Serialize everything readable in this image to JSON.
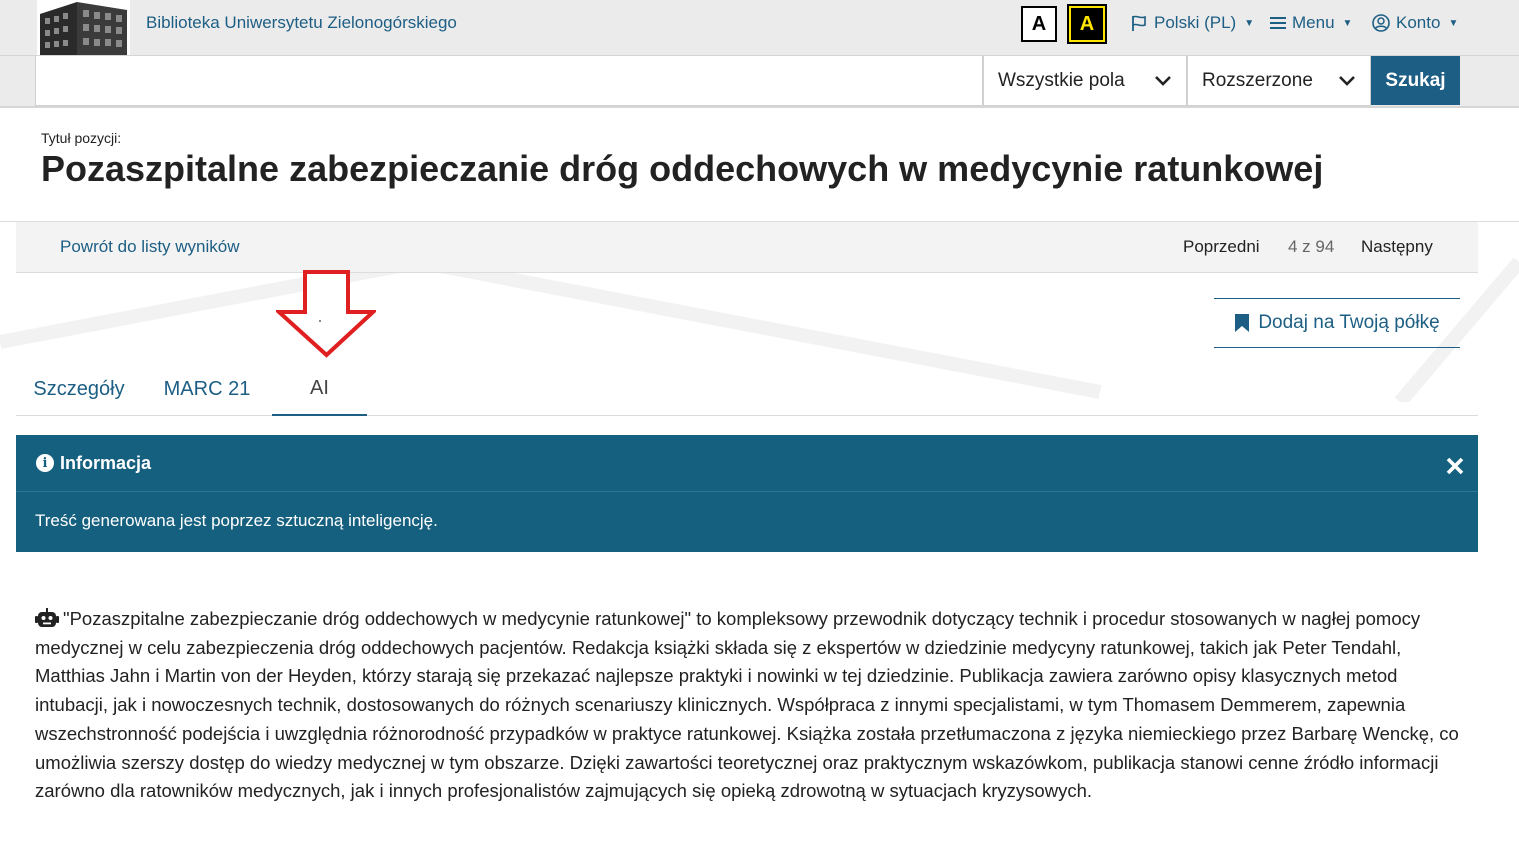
{
  "header": {
    "site_name": "Biblioteka Uniwersytetu Zielonogórskiego",
    "contrast_normal_label": "A",
    "contrast_high_label": "A",
    "language_label": "Polski (PL)",
    "menu_label": "Menu",
    "account_label": "Konto"
  },
  "search": {
    "query": "",
    "field_select": "Wszystkie pola",
    "mode_select": "Rozszerzone",
    "submit_label": "Szukaj"
  },
  "record": {
    "title_label": "Tytuł pozycji:",
    "title": "Pozaszpitalne zabezpieczanie dróg oddechowych w medycynie ratunkowej"
  },
  "result_nav": {
    "back_label": "Powrót do listy wyników",
    "prev_label": "Poprzedni",
    "counter": "4 z 94",
    "next_label": "Następny"
  },
  "shelf": {
    "label": "Dodaj na Twoją półkę"
  },
  "tabs": [
    {
      "label": "Szczegóły",
      "active": false
    },
    {
      "label": "MARC 21",
      "active": false
    },
    {
      "label": "AI",
      "active": true
    }
  ],
  "alert": {
    "title": "Informacja",
    "body": "Treść generowana jest poprzez sztuczną inteligencję."
  },
  "ai_summary": {
    "text": "\"Pozaszpitalne zabezpieczanie dróg oddechowych w medycynie ratunkowej\" to kompleksowy przewodnik dotyczący technik i procedur stosowanych w nagłej pomocy medycznej w celu zabezpieczenia dróg oddechowych pacjentów. Redakcja książki składa się z ekspertów w dziedzinie medycyny ratunkowej, takich jak Peter Tendahl, Matthias Jahn i Martin von der Heyden, którzy starają się przekazać najlepsze praktyki i nowinki w tej dziedzinie. Publikacja zawiera zarówno opisy klasycznych metod intubacji, jak i nowoczesnych technik, dostosowanych do różnych scenariuszy klinicznych. Współpraca z innymi specjalistami, w tym Thomasem Demmerem, zapewnia wszechstronność podejścia i uwzględnia różnorodność przypadków w praktyce ratunkowej. Książka została przetłumaczona z języka niemieckiego przez Barbarę Wenckę, co umożliwia szerszy dostęp do wiedzy medycznej w tym obszarze. Dzięki zawartości teoretycznej oraz praktycznym wskazówkom, publikacja stanowi cenne źródło informacji zarówno dla ratowników medycznych, jak i innych profesjonalistów zajmujących się opieką zdrowotną w sytuacjach kryzysowych."
  },
  "colors": {
    "brand": "#1d5e84",
    "alert_bg": "#16607f",
    "annotation_arrow": "#e02020"
  },
  "icons": {
    "logo": "library-building-logo",
    "language": "flag-icon",
    "menu": "hamburger-icon",
    "account": "user-circle-icon",
    "shelf": "bookmark-icon",
    "alert": "info-circle-icon",
    "close": "close-icon",
    "summary": "robot-icon"
  }
}
